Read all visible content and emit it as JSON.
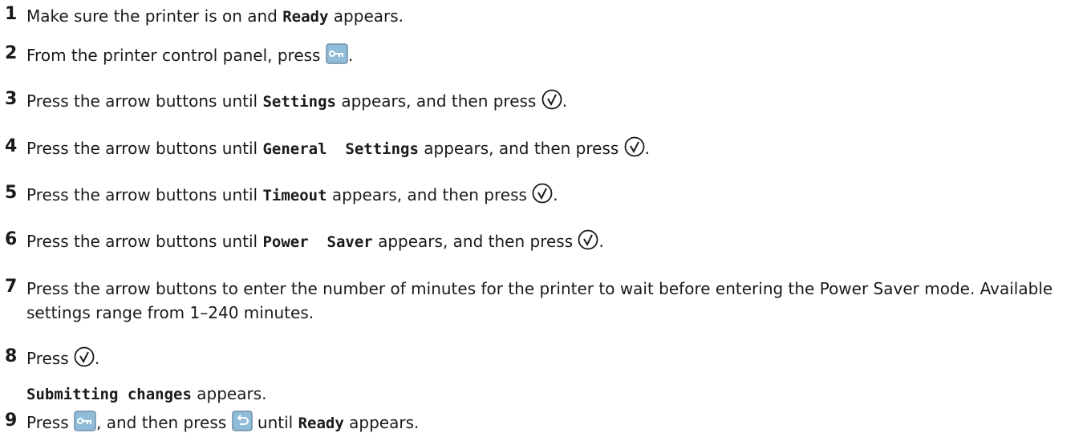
{
  "colors": {
    "text": "#1a1a1a",
    "icon_button_fill": "#8fbcd8",
    "icon_button_border": "#6f8fa8"
  },
  "icons": [
    "menu-key-icon",
    "select-check-icon",
    "back-arrow-icon"
  ],
  "steps": [
    {
      "num": "1",
      "pre": "Make sure the printer is on and ",
      "code": "Ready",
      "post": " appears."
    },
    {
      "num": "2",
      "pre": "From the printer control panel, press ",
      "post": "."
    },
    {
      "num": "3",
      "pre": "Press the arrow buttons until ",
      "code": "Settings",
      "post": " appears, and then press ",
      "end": "."
    },
    {
      "num": "4",
      "pre": "Press the arrow buttons until ",
      "code": "General  Settings",
      "post": " appears, and then press ",
      "end": "."
    },
    {
      "num": "5",
      "pre": "Press the arrow buttons until ",
      "code": "Timeout",
      "post": " appears, and then press ",
      "end": "."
    },
    {
      "num": "6",
      "pre": "Press the arrow buttons until ",
      "code": "Power  Saver",
      "post": " appears, and then press ",
      "end": "."
    },
    {
      "num": "7",
      "text": "Press the arrow buttons to enter the number of minutes for the printer to wait before entering the Power Saver mode. Available settings range from 1–240 minutes."
    },
    {
      "num": "8",
      "pre": "Press ",
      "post": ".",
      "sub_code": "Submitting changes",
      "sub_post": " appears."
    },
    {
      "num": "9",
      "pre": "Press ",
      "mid": ", and then press ",
      "mid2": " until ",
      "code": "Ready",
      "post": " appears."
    }
  ]
}
